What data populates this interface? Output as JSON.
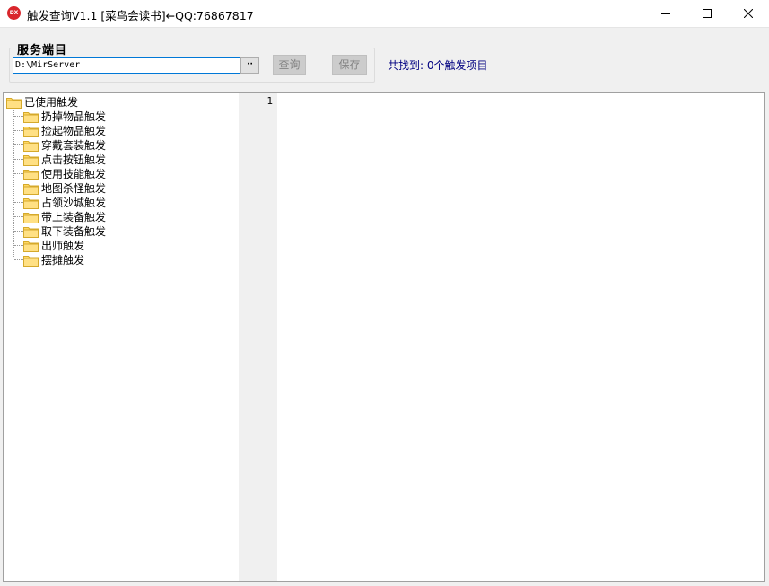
{
  "window": {
    "icon_text": "DX",
    "title": "触发查询V1.1 [菜鸟会读书]←QQ:76867817"
  },
  "server": {
    "group_label": "服务端目",
    "path_value": "D:\\MirServer",
    "browse_label": "··",
    "query_label": "查询",
    "save_label": "保存",
    "found_text": "共找到: 0个触发项目"
  },
  "tree": {
    "root": "已使用触发",
    "items": [
      "扔掉物品触发",
      "捡起物品触发",
      "穿戴套装触发",
      "点击按钮触发",
      "使用技能触发",
      "地图杀怪触发",
      "占领沙城触发",
      "带上装备触发",
      "取下装备触发",
      "出师触发",
      "摆摊触发"
    ]
  },
  "editor": {
    "line_numbers": [
      "1"
    ]
  },
  "colors": {
    "accent": "#0078d7",
    "found_text": "#000080",
    "folder": "#ffd863"
  }
}
